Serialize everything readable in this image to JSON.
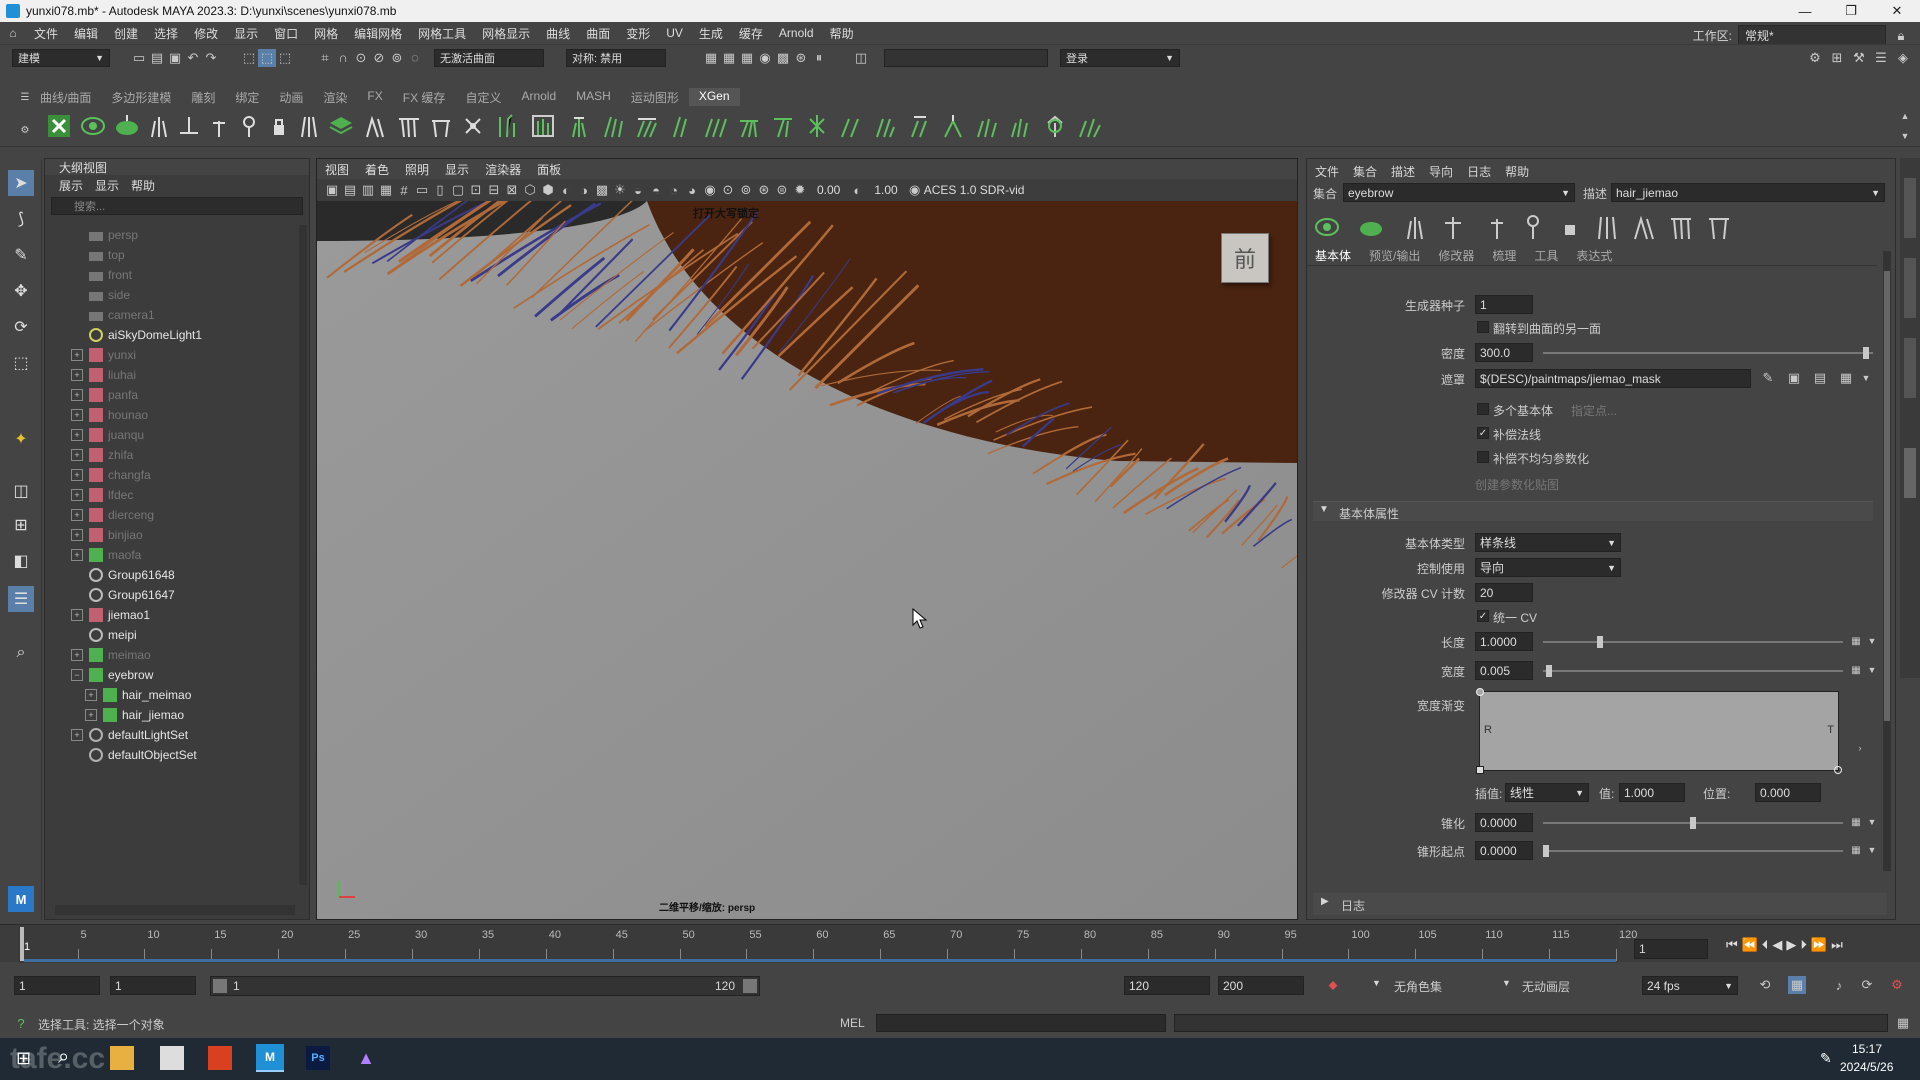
{
  "window": {
    "title": "yunxi078.mb* - Autodesk MAYA 2023.3: D:\\yunxi\\scenes\\yunxi078.mb",
    "controls": [
      "—",
      "❐",
      "✕"
    ]
  },
  "menubar": {
    "items": [
      "文件",
      "编辑",
      "创建",
      "选择",
      "修改",
      "显示",
      "窗口",
      "网格",
      "编辑网格",
      "网格工具",
      "网格显示",
      "曲线",
      "曲面",
      "变形",
      "UV",
      "生成",
      "缓存",
      "Arnold",
      "帮助"
    ],
    "workspace_label": "工作区:",
    "workspace_value": "常规*"
  },
  "statusline": {
    "mode": "建模",
    "live_surface": "无激活曲面",
    "symmetry": "对称: 禁用",
    "login": "登录"
  },
  "shelf": {
    "tabs": [
      "曲线/曲面",
      "多边形建模",
      "雕刻",
      "绑定",
      "动画",
      "渲染",
      "FX",
      "FX 缓存",
      "自定义",
      "Arnold",
      "MASH",
      "运动图形",
      "XGen"
    ],
    "active_tab": "XGen"
  },
  "outliner": {
    "title": "大纲视图",
    "menu": [
      "展示",
      "显示",
      "帮助"
    ],
    "search_placeholder": "搜索...",
    "items": [
      {
        "label": "persp",
        "type": "camera",
        "dim": true,
        "expandable": false,
        "indent": 0
      },
      {
        "label": "top",
        "type": "camera",
        "dim": true,
        "expandable": false,
        "indent": 0
      },
      {
        "label": "front",
        "type": "camera",
        "dim": true,
        "expandable": false,
        "indent": 0
      },
      {
        "label": "side",
        "type": "camera",
        "dim": true,
        "expandable": false,
        "indent": 0
      },
      {
        "label": "camera1",
        "type": "camera",
        "dim": true,
        "expandable": false,
        "indent": 0
      },
      {
        "label": "aiSkyDomeLight1",
        "type": "light",
        "dim": false,
        "expandable": false,
        "indent": 0
      },
      {
        "label": "yunxi",
        "type": "mesh",
        "dim": true,
        "expandable": true,
        "indent": 0
      },
      {
        "label": "liuhai",
        "type": "mesh",
        "dim": true,
        "expandable": true,
        "indent": 0
      },
      {
        "label": "panfa",
        "type": "mesh",
        "dim": true,
        "expandable": true,
        "indent": 0
      },
      {
        "label": "hounao",
        "type": "mesh",
        "dim": true,
        "expandable": true,
        "indent": 0
      },
      {
        "label": "juanqu",
        "type": "mesh",
        "dim": true,
        "expandable": true,
        "indent": 0
      },
      {
        "label": "zhifa",
        "type": "mesh",
        "dim": true,
        "expandable": true,
        "indent": 0
      },
      {
        "label": "changfa",
        "type": "mesh",
        "dim": true,
        "expandable": true,
        "indent": 0
      },
      {
        "label": "lfdec",
        "type": "mesh",
        "dim": true,
        "expandable": true,
        "indent": 0
      },
      {
        "label": "dierceng",
        "type": "mesh",
        "dim": true,
        "expandable": true,
        "indent": 0
      },
      {
        "label": "binjiao",
        "type": "mesh",
        "dim": true,
        "expandable": true,
        "indent": 0
      },
      {
        "label": "maofa",
        "type": "xgen",
        "dim": true,
        "expandable": true,
        "indent": 0
      },
      {
        "label": "Group61648",
        "type": "group",
        "dim": false,
        "expandable": false,
        "indent": 0
      },
      {
        "label": "Group61647",
        "type": "group",
        "dim": false,
        "expandable": false,
        "indent": 0
      },
      {
        "label": "jiemao1",
        "type": "mesh",
        "dim": false,
        "expandable": true,
        "indent": 0
      },
      {
        "label": "meipi",
        "type": "group",
        "dim": false,
        "expandable": false,
        "indent": 0
      },
      {
        "label": "meimao",
        "type": "xgen",
        "dim": true,
        "expandable": true,
        "indent": 0
      },
      {
        "label": "eyebrow",
        "type": "xgen",
        "dim": false,
        "expandable": true,
        "expanded": true,
        "indent": 0
      },
      {
        "label": "hair_meimao",
        "type": "xgen",
        "dim": false,
        "expandable": true,
        "indent": 1
      },
      {
        "label": "hair_jiemao",
        "type": "xgen",
        "dim": false,
        "expandable": true,
        "indent": 1
      },
      {
        "label": "defaultLightSet",
        "type": "set",
        "dim": false,
        "expandable": true,
        "indent": 0
      },
      {
        "label": "defaultObjectSet",
        "type": "set",
        "dim": false,
        "expandable": false,
        "indent": 0
      }
    ]
  },
  "viewport": {
    "menu": [
      "视图",
      "着色",
      "照明",
      "显示",
      "渲染器",
      "面板"
    ],
    "exposure": "0.00",
    "gamma": "1.00",
    "colorspace": "ACES 1.0 SDR-vid",
    "hud_top": "打开大写锁定",
    "hud_bottom": "二维平移/缩放: persp",
    "viewcube": "前"
  },
  "xgen": {
    "menu": [
      "文件",
      "集合",
      "描述",
      "导向",
      "日志",
      "帮助"
    ],
    "collection_label": "集合",
    "collection_value": "eyebrow",
    "description_label": "描述",
    "description_value": "hair_jiemao",
    "tabs": [
      "基本体",
      "预览/输出",
      "修改器",
      "梳理",
      "工具",
      "表达式"
    ],
    "active_tab": "基本体",
    "seed_label": "生成器种子",
    "seed_value": "1",
    "flip_label": "翻转到曲面的另一面",
    "density_label": "密度",
    "density_value": "300.0",
    "density_slider_fraction": 0.98,
    "mask_label": "遮罩",
    "mask_value": "$(DESC)/paintmaps/jiemao_mask",
    "multi_base_label": "多个基本体",
    "specify_points": "指定点...",
    "compensate_normal_label": "补偿法线",
    "compensate_normal_checked": true,
    "compensate_param_label": "补偿不均匀参数化",
    "create_param_map": "创建参数化贴图",
    "section_title": "基本体属性",
    "prim_type_label": "基本体类型",
    "prim_type_value": "样条线",
    "control_label": "控制使用",
    "control_value": "导向",
    "cv_count_label": "修改器 CV 计数",
    "cv_count_value": "20",
    "unify_cv_label": "统一 CV",
    "unify_cv_checked": true,
    "length_label": "长度",
    "length_value": "1.0000",
    "length_slider_fraction": 0.19,
    "width_label": "宽度",
    "width_value": "0.005",
    "width_slider_fraction": 0.02,
    "width_ramp_label": "宽度渐变",
    "ramp_R": "R",
    "ramp_T": "T",
    "interp_label": "插值:",
    "interp_value": "线性",
    "ramp_value_label": "值:",
    "ramp_value": "1.000",
    "ramp_pos_label": "位置:",
    "ramp_pos": "0.000",
    "taper_label": "锥化",
    "taper_value": "0.0000",
    "taper_slider_fraction": 0.5,
    "taper_start_label": "锥形起点",
    "taper_start_value": "0.0000",
    "log_label": "日志"
  },
  "timeline": {
    "ticks": [
      "5",
      "10",
      "15",
      "20",
      "25",
      "30",
      "35",
      "40",
      "45",
      "50",
      "55",
      "60",
      "65",
      "70",
      "75",
      "80",
      "85",
      "90",
      "95",
      "100",
      "105",
      "110",
      "115",
      "120"
    ],
    "current_frame": "1",
    "first_mark": "1"
  },
  "range": {
    "start": "1",
    "playback_start": "1",
    "slider_start": "1",
    "slider_end": "120",
    "playback_end": "120",
    "end": "200",
    "char_set": "无角色集",
    "anim_layer": "无动画层",
    "fps": "24 fps"
  },
  "cmdline": {
    "help": "选择工具: 选择一个对象",
    "lang": "MEL"
  },
  "taskbar": {
    "time": "15:17",
    "date": "2024/5/26",
    "watermark": "tafe.cc"
  }
}
